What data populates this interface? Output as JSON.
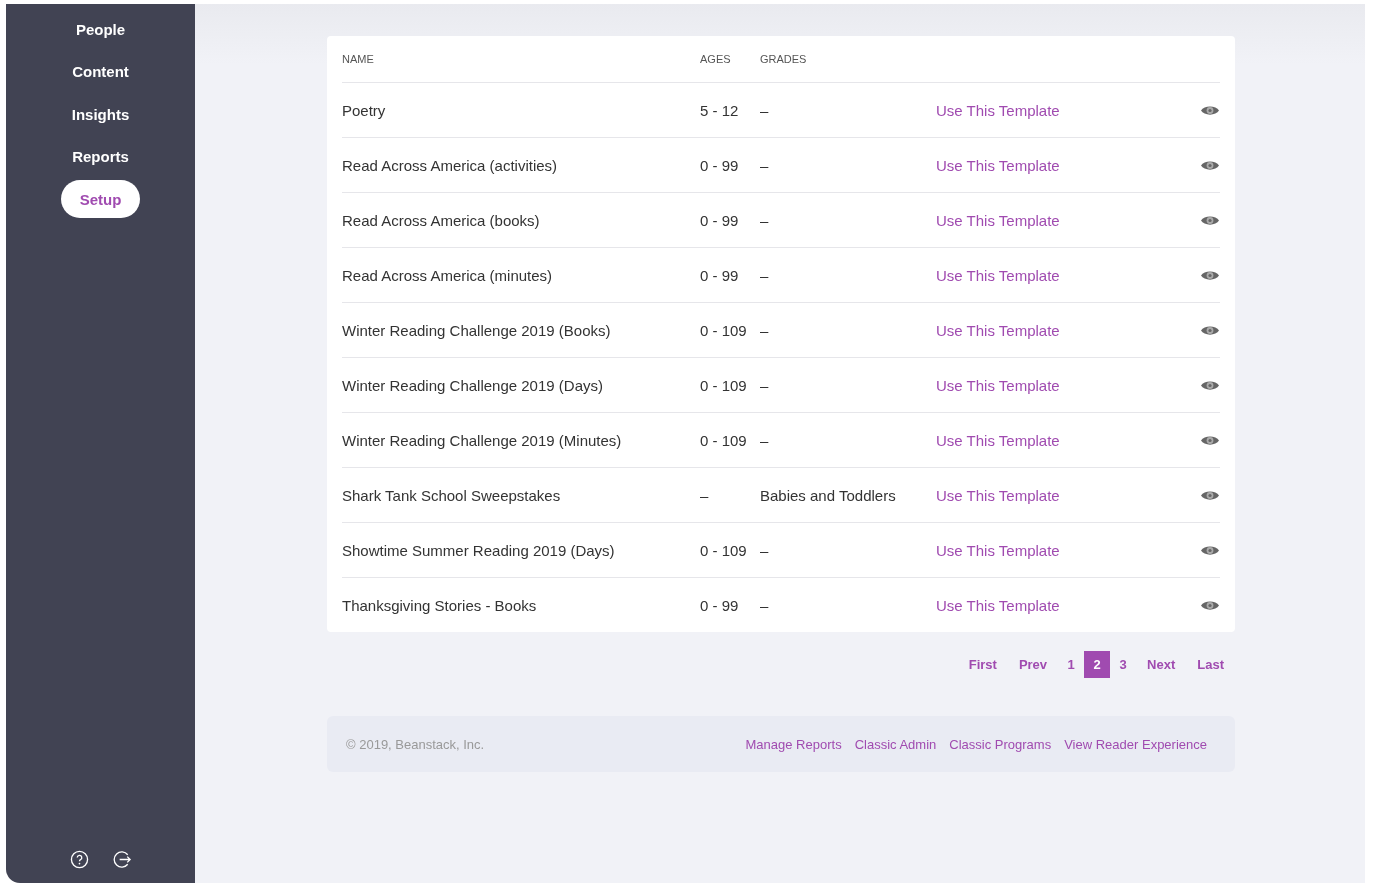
{
  "sidebar": {
    "items": [
      {
        "label": "People",
        "selected": false
      },
      {
        "label": "Content",
        "selected": false
      },
      {
        "label": "Insights",
        "selected": false
      },
      {
        "label": "Reports",
        "selected": false
      },
      {
        "label": "Setup",
        "selected": true
      }
    ]
  },
  "table": {
    "columns": [
      "NAME",
      "AGES",
      "GRADES"
    ],
    "rows": [
      {
        "name": "Poetry",
        "ages": "5 - 12",
        "grades": "–",
        "action": "Use This Template"
      },
      {
        "name": "Read Across America (activities)",
        "ages": "0 - 99",
        "grades": "–",
        "action": "Use This Template"
      },
      {
        "name": "Read Across America (books)",
        "ages": "0 - 99",
        "grades": "–",
        "action": "Use This Template"
      },
      {
        "name": "Read Across America (minutes)",
        "ages": "0 - 99",
        "grades": "–",
        "action": "Use This Template"
      },
      {
        "name": "Winter Reading Challenge 2019 (Books)",
        "ages": "0 - 109",
        "grades": "–",
        "action": "Use This Template"
      },
      {
        "name": "Winter Reading Challenge 2019 (Days)",
        "ages": "0 - 109",
        "grades": "–",
        "action": "Use This Template"
      },
      {
        "name": "Winter Reading Challenge 2019 (Minutes)",
        "ages": "0 - 109",
        "grades": "–",
        "action": "Use This Template"
      },
      {
        "name": "Shark Tank School Sweepstakes",
        "ages": "–",
        "grades": "Babies and Toddlers",
        "action": "Use This Template"
      },
      {
        "name": "Showtime Summer Reading 2019 (Days)",
        "ages": "0 - 109",
        "grades": "–",
        "action": "Use This Template"
      },
      {
        "name": "Thanksgiving Stories - Books",
        "ages": "0 - 99",
        "grades": "–",
        "action": "Use This Template"
      }
    ]
  },
  "pagination": [
    {
      "label": "First",
      "selected": false
    },
    {
      "label": "Prev",
      "selected": false
    },
    {
      "label": "1",
      "selected": false
    },
    {
      "label": "2",
      "selected": true
    },
    {
      "label": "3",
      "selected": false
    },
    {
      "label": "Next",
      "selected": false
    },
    {
      "label": "Last",
      "selected": false
    }
  ],
  "footer": {
    "copyright": "© 2019, Beanstack, Inc.",
    "links": [
      "Manage Reports",
      "Classic Admin",
      "Classic Programs",
      "View Reader Experience"
    ]
  }
}
